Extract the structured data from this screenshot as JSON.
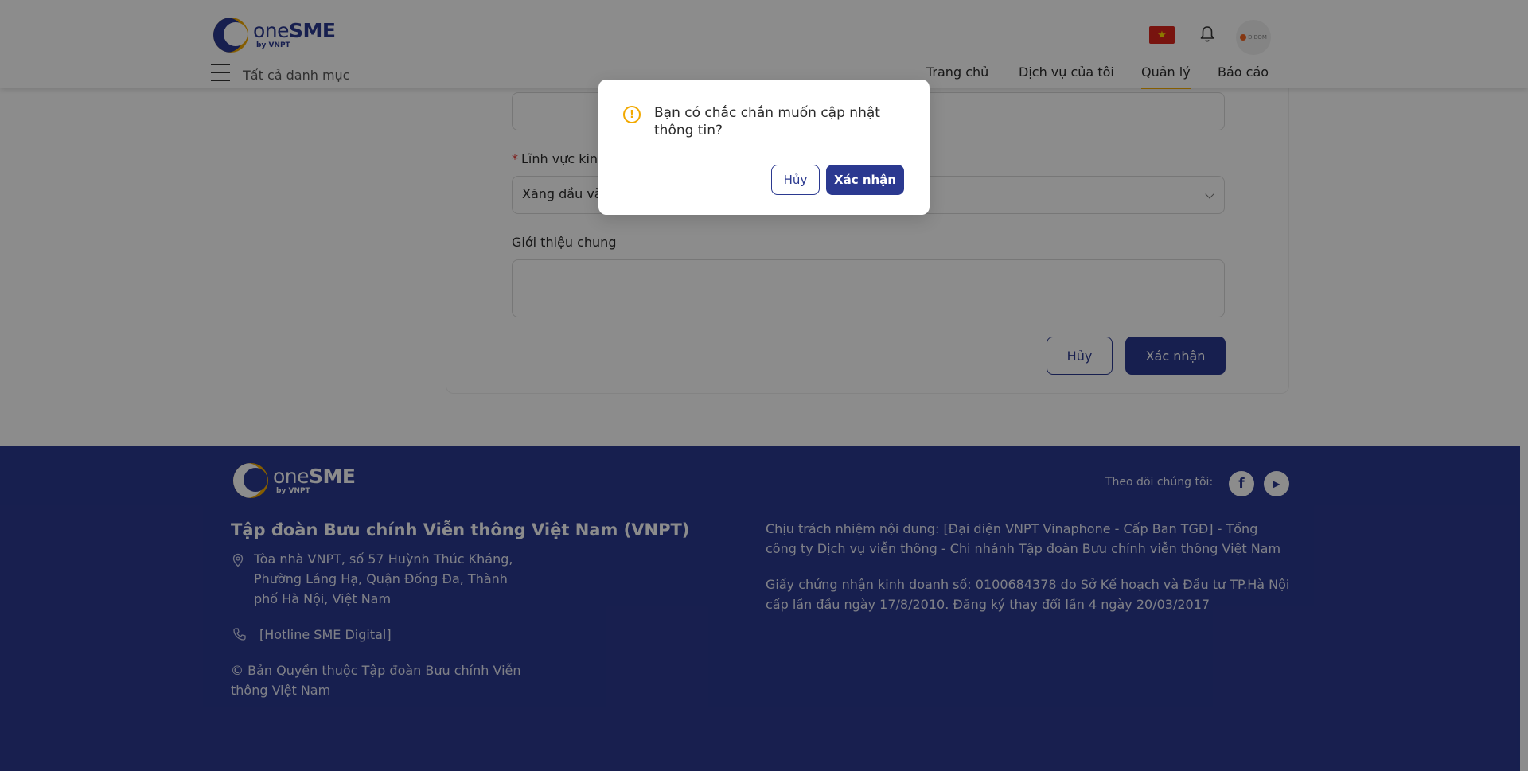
{
  "header": {
    "logo_text_one": "one",
    "logo_text_sme": "SME",
    "logo_by": "by VNPT",
    "categories_label": "Tất cả danh mục",
    "nav": [
      {
        "label": "Trang chủ"
      },
      {
        "label": "Dịch vụ của tôi"
      },
      {
        "label": "Quản lý",
        "active": true
      },
      {
        "label": "Báo cáo"
      }
    ],
    "flag": "★",
    "avatar_text": "ĐIBOM"
  },
  "form": {
    "field_business_label": "Lĩnh vực kinh doanh",
    "field_business_value": "Xăng dầu và khí đốt",
    "field_intro_label": "Giới thiệu chung",
    "cancel_label": "Hủy",
    "confirm_label": "Xác nhận"
  },
  "dialog": {
    "message": "Bạn có chắc chắn muốn cập nhật thông tin?",
    "cancel_label": "Hủy",
    "confirm_label": "Xác nhận",
    "warn_symbol": "!"
  },
  "footer": {
    "company": "Tập đoàn Bưu chính Viễn thông Việt Nam (VNPT)",
    "address": "Tòa nhà VNPT, số 57 Huỳnh Thúc Kháng, Phường Láng Hạ, Quận Đống Đa, Thành phố Hà Nội, Việt Nam",
    "hotline": "[Hotline SME Digital]",
    "copyright": "© Bản Quyền thuộc Tập đoàn Bưu chính Viễn thông Việt Nam",
    "responsibility": "Chịu trách nhiệm nội dung: [Đại diện VNPT Vinaphone - Cấp Ban TGĐ] - Tổng công ty Dịch vụ viễn thông - Chi nhánh Tập đoàn Bưu chính viễn thông Việt Nam",
    "license": "Giấy chứng nhận kinh doanh số: 0100684378 do Sở Kế hoạch và Đầu tư TP.Hà Nội cấp lần đầu ngày 17/8/2010. Đăng ký thay đổi lần 4 ngày 20/03/2017",
    "follow_label": "Theo dõi chúng tôi:",
    "facebook": "f",
    "youtube": "▶"
  },
  "colors": {
    "brand": "#2b3990",
    "accent": "#f2a900"
  }
}
